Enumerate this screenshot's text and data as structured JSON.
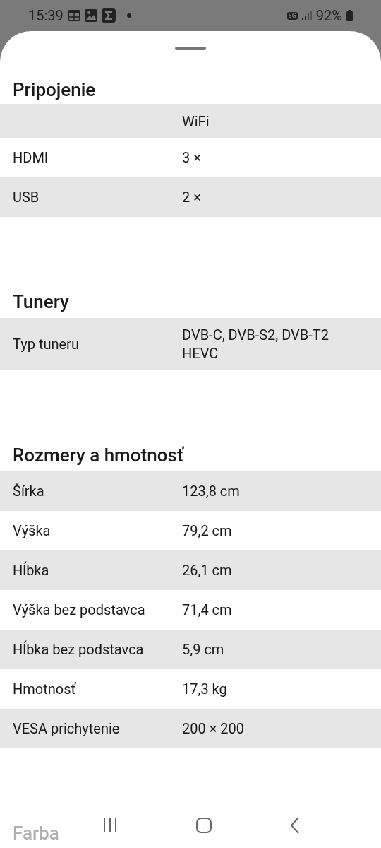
{
  "status_bar": {
    "time": "15:39",
    "network": "5G",
    "battery": "92%"
  },
  "sections": [
    {
      "title": "Pripojenie",
      "rows": [
        {
          "value": "WiFi",
          "cut_off": true
        },
        {
          "label": "HDMI",
          "value": "3 ×",
          "cut_off": false
        },
        {
          "label": "USB",
          "value": "2 ×",
          "cut_off": false
        }
      ]
    },
    {
      "title": "Tunery",
      "rows": [
        {
          "label": "Typ tuneru",
          "value": "DVB-C, DVB-S2, DVB-T2 HEVC",
          "cut_off": false
        }
      ]
    },
    {
      "title": "Rozmery a hmotnosť",
      "rows": [
        {
          "label": "Šírka",
          "value": "123,8 cm",
          "cut_off": false
        },
        {
          "label": "Výška",
          "value": "79,2 cm",
          "cut_off": false
        },
        {
          "label": "Hĺbka",
          "value": "26,1 cm",
          "cut_off": false
        },
        {
          "label": "Výška bez podstavca",
          "value": "71,4 cm",
          "cut_off": false
        },
        {
          "label": "Hĺbka bez podstavca",
          "value": "5,9 cm",
          "cut_off": false
        },
        {
          "label": "Hmotnosť",
          "value": "17,3 kg",
          "cut_off": false
        },
        {
          "label": "VESA prichytenie",
          "value": "200 × 200",
          "cut_off": false
        }
      ]
    }
  ],
  "next_section_title": "Farba"
}
